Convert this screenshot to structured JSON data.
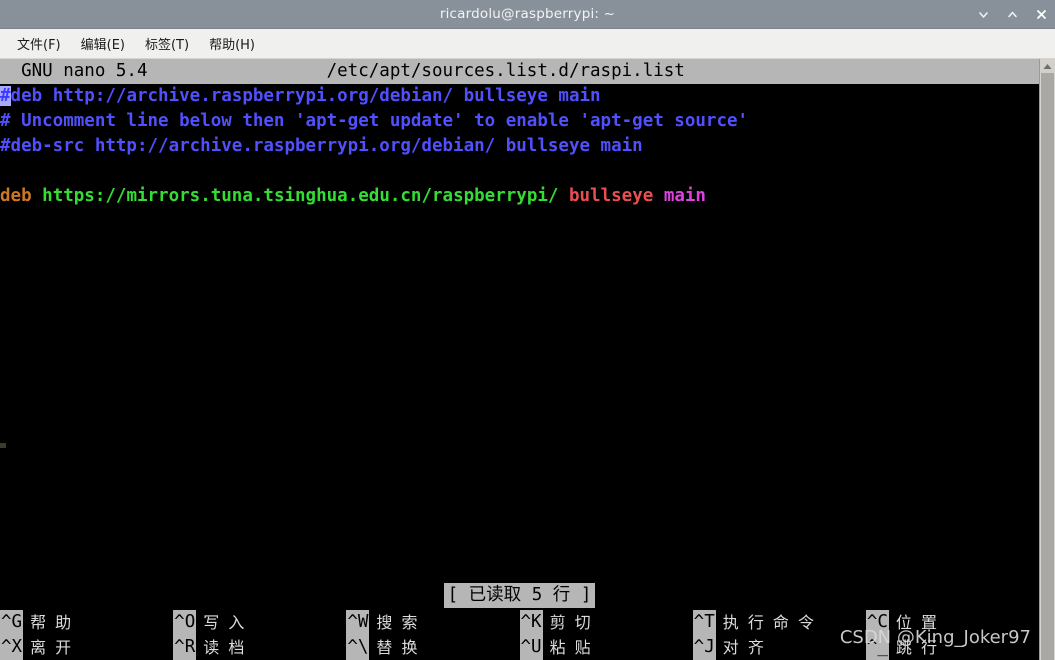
{
  "window": {
    "title": "ricardolu@raspberrypi: ~",
    "controls": {
      "minimize_label": "minimize",
      "maximize_label": "maximize",
      "close_label": "close"
    },
    "colors": {
      "titlebar_bg": "#889099",
      "menubar_bg": "#f0f0ef",
      "terminal_bg": "#000000",
      "nano_bar_bg": "#b6b6b6"
    }
  },
  "menubar": {
    "items": [
      {
        "label": "文件(F)"
      },
      {
        "label": "编辑(E)"
      },
      {
        "label": "标签(T)"
      },
      {
        "label": "帮助(H)"
      }
    ]
  },
  "nano": {
    "version_label": "GNU nano 5.4",
    "filename": "/etc/apt/sources.list.d/raspi.list",
    "titlebar_text": "  GNU nano 5.4                 /etc/apt/sources.list.d/raspi.list",
    "status_message": "[ 已读取 5 行 ]",
    "lines": [
      {
        "index": 1,
        "text": "#deb http://archive.raspberrypi.org/debian/ bullseye main",
        "cursor_char": "#",
        "rest": "deb http://archive.raspberrypi.org/debian/ bullseye main"
      },
      {
        "index": 2,
        "text": "# Uncomment line below then 'apt-get update' to enable 'apt-get source'"
      },
      {
        "index": 3,
        "text": "#deb-src http://archive.raspberrypi.org/debian/ bullseye main"
      },
      {
        "index": 4,
        "text": ""
      },
      {
        "index": 5,
        "keyword": "deb",
        "url_scheme": "https://mirrors",
        "url_rest": ".tuna.tsinghua.edu.cn/raspberrypi/",
        "distribution": "bullseye",
        "component": "main",
        "text": "deb https://mirrors.tuna.tsinghua.edu.cn/raspberrypi/ bullseye main"
      }
    ],
    "line_colors": {
      "comment": "#5050ff",
      "cursor_bg": "#a8a8ff",
      "keyword": "#cc7722",
      "url": "#33dd33",
      "distribution": "#e85050",
      "component": "#e040e0"
    },
    "shortcuts": [
      {
        "key": "^G",
        "label": "帮 助"
      },
      {
        "key": "^X",
        "label": "离 开"
      },
      {
        "key": "^O",
        "label": "写 入"
      },
      {
        "key": "^R",
        "label": "读 档"
      },
      {
        "key": "^W",
        "label": "搜 索"
      },
      {
        "key": "^\\",
        "label": "替 换"
      },
      {
        "key": "^K",
        "label": "剪 切"
      },
      {
        "key": "^U",
        "label": "粘 贴"
      },
      {
        "key": "^T",
        "label": "执 行 命 令"
      },
      {
        "key": "^J",
        "label": "对 齐"
      },
      {
        "key": "^C",
        "label": "位 置"
      },
      {
        "key": "^_",
        "label": "跳 行"
      }
    ]
  },
  "watermark": {
    "text": "CSDN @King_Joker97"
  }
}
